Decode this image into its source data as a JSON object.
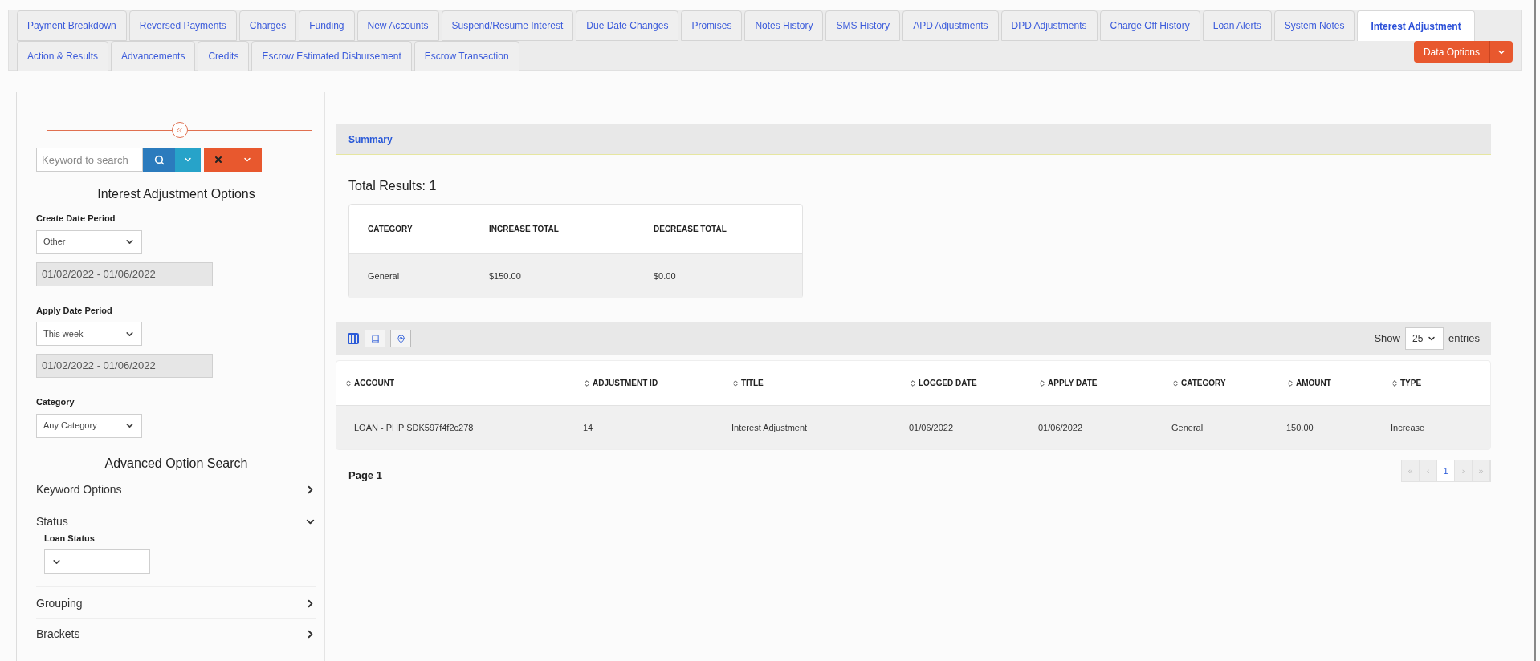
{
  "tabs": [
    [
      {
        "label": "Payment Breakdown",
        "selected": false
      },
      {
        "label": "Reversed Payments",
        "selected": false
      },
      {
        "label": "Charges",
        "selected": false
      },
      {
        "label": "Funding",
        "selected": false
      },
      {
        "label": "New Accounts",
        "selected": false
      },
      {
        "label": "Suspend/Resume Interest",
        "selected": false
      },
      {
        "label": "Due Date Changes",
        "selected": false
      },
      {
        "label": "Promises",
        "selected": false
      },
      {
        "label": "Notes History",
        "selected": false
      },
      {
        "label": "SMS History",
        "selected": false
      },
      {
        "label": "APD Adjustments",
        "selected": false
      },
      {
        "label": "DPD Adjustments",
        "selected": false
      },
      {
        "label": "Charge Off History",
        "selected": false
      },
      {
        "label": "Loan Alerts",
        "selected": false
      },
      {
        "label": "System Notes",
        "selected": false
      },
      {
        "label": "Interest Adjustment",
        "selected": true
      }
    ],
    [
      {
        "label": "Action & Results",
        "selected": false
      },
      {
        "label": "Advancements",
        "selected": false
      },
      {
        "label": "Credits",
        "selected": false
      },
      {
        "label": "Escrow Estimated Disbursement",
        "selected": false
      },
      {
        "label": "Escrow Transaction",
        "selected": false
      }
    ]
  ],
  "data_options": "Data Options",
  "sidebar": {
    "search_placeholder": "Keyword to search",
    "options_title": "Interest Adjustment Options",
    "filters": [
      {
        "label": "Create Date Period",
        "value": "Other",
        "range": "01/02/2022 - 01/06/2022"
      },
      {
        "label": "Apply Date Period",
        "value": "This week",
        "range": "01/02/2022 - 01/06/2022"
      },
      {
        "label": "Category",
        "value": "Any Category"
      }
    ],
    "advanced_title": "Advanced Option Search",
    "sections": [
      {
        "label": "Keyword Options",
        "expanded": false
      },
      {
        "label": "Status",
        "expanded": true,
        "field_label": "Loan Status"
      },
      {
        "label": "Grouping",
        "expanded": false
      },
      {
        "label": "Brackets",
        "expanded": false
      }
    ]
  },
  "summary": {
    "title": "Summary",
    "total": "Total Results: 1",
    "columns": [
      "CATEGORY",
      "INCREASE TOTAL",
      "DECREASE TOTAL"
    ],
    "rows": [
      [
        "General",
        "$150.00",
        "$0.00"
      ]
    ]
  },
  "table": {
    "show_label": "Show",
    "page_size": "25",
    "entries_label": "entries",
    "columns": [
      "ACCOUNT",
      "ADJUSTMENT ID",
      "TITLE",
      "LOGGED DATE",
      "APPLY DATE",
      "CATEGORY",
      "AMOUNT",
      "TYPE"
    ],
    "rows": [
      [
        "LOAN - PHP SDK597f4f2c278",
        "14",
        "Interest Adjustment",
        "01/06/2022",
        "01/06/2022",
        "General",
        "150.00",
        "Increase"
      ]
    ],
    "page_label": "Page 1",
    "pagination": [
      {
        "label": "«",
        "selected": false,
        "disabled": true
      },
      {
        "label": "‹",
        "selected": false,
        "disabled": true
      },
      {
        "label": "1",
        "selected": true,
        "disabled": false
      },
      {
        "label": "›",
        "selected": false,
        "disabled": true
      },
      {
        "label": "»",
        "selected": false,
        "disabled": true
      }
    ]
  }
}
